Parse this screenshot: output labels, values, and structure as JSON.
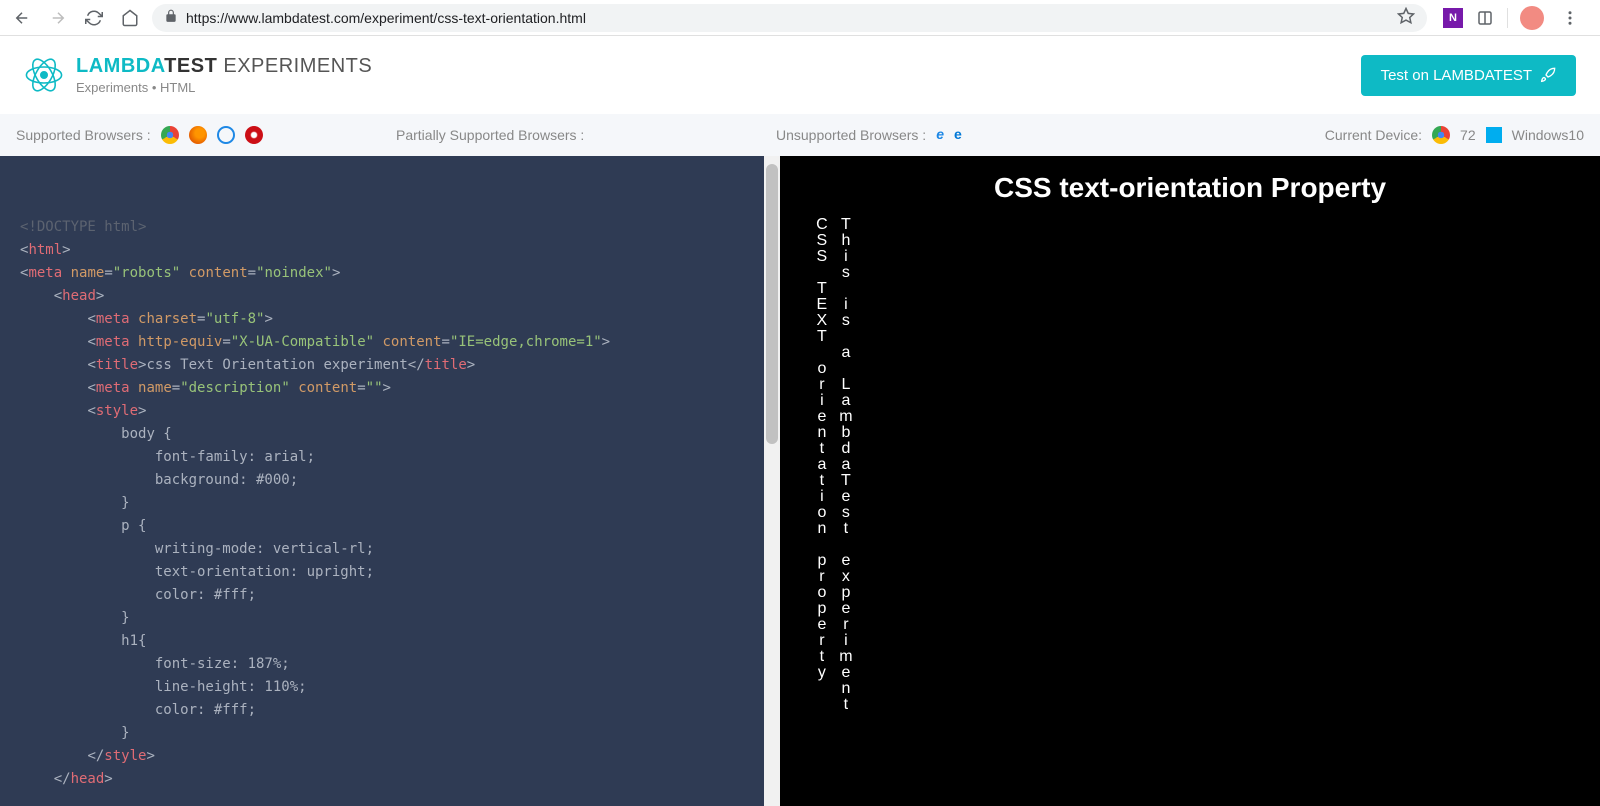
{
  "browser": {
    "url": "https://www.lambdatest.com/experiment/css-text-orientation.html"
  },
  "header": {
    "brand_primary": "LAMBDA",
    "brand_secondary": "TEST",
    "brand_suffix": "EXPERIMENTS",
    "breadcrumb": "Experiments • HTML",
    "cta": "Test on LAMBDATEST"
  },
  "infobar": {
    "supported_label": "Supported Browsers :",
    "partial_label": "Partially Supported Browsers :",
    "unsupported_label": "Unsupported Browsers :",
    "device_label": "Current Device:",
    "browser_version": "72",
    "os": "Windows10"
  },
  "code": {
    "line01": "<!DOCTYPE html>",
    "tag_html": "html",
    "tag_meta": "meta",
    "attr_name": "name",
    "val_robots": "\"robots\"",
    "attr_content": "content",
    "val_noindex": "\"noindex\"",
    "tag_head": "head",
    "attr_charset": "charset",
    "val_utf8": "\"utf-8\"",
    "attr_httpequiv": "http-equiv",
    "val_xua": "\"X-UA-Compatible\"",
    "val_ieedge": "\"IE=edge,chrome=1\"",
    "tag_title": "title",
    "title_text": "css Text Orientation experiment",
    "val_desc": "\"description\"",
    "val_empty": "\"\"",
    "tag_style": "style",
    "css_body": "body {",
    "css_ff": "font-family: arial;",
    "css_bg": "background: #000;",
    "css_close": "}",
    "css_p": "p {",
    "css_wm": "writing-mode: vertical-rl;",
    "css_to": "text-orientation: upright;",
    "css_colorw": "color: #fff;",
    "css_h1": "h1{",
    "css_fs": "font-size: 187%;",
    "css_lh": "line-height: 110%;"
  },
  "preview": {
    "heading": "CSS text-orientation Property",
    "para1": "CSS TEXT orientation property",
    "para2": "This is a LambdaTest experiment"
  }
}
